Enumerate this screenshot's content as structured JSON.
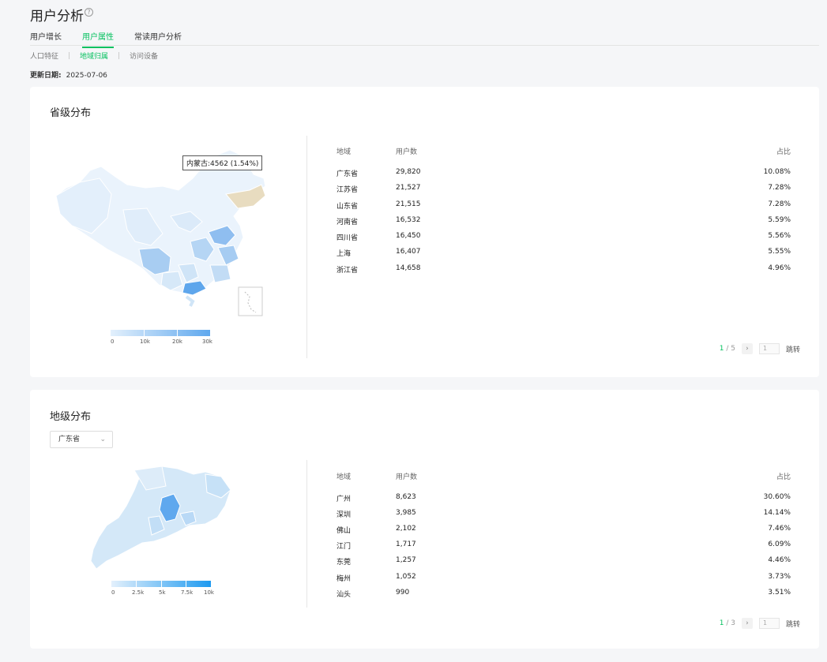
{
  "header": {
    "title": "用户分析",
    "help_icon": "?"
  },
  "tabs": [
    {
      "label": "用户增长",
      "active": false
    },
    {
      "label": "用户属性",
      "active": true
    },
    {
      "label": "常读用户分析",
      "active": false
    }
  ],
  "subtabs": [
    {
      "label": "人口特征",
      "active": false
    },
    {
      "label": "地域归属",
      "active": true
    },
    {
      "label": "访问设备",
      "active": false
    }
  ],
  "update": {
    "label": "更新日期:",
    "date": "2025-07-06"
  },
  "province": {
    "title": "省级分布",
    "tooltip": "内蒙古:4562 (1.54%)",
    "legend_ticks": [
      "0",
      "10k",
      "20k",
      "30k"
    ],
    "headers": {
      "region": "地域",
      "users": "用户数",
      "ratio": "占比"
    },
    "rows": [
      {
        "region": "广东省",
        "users": "29,820",
        "ratio": "10.08%"
      },
      {
        "region": "江苏省",
        "users": "21,527",
        "ratio": "7.28%"
      },
      {
        "region": "山东省",
        "users": "21,515",
        "ratio": "7.28%"
      },
      {
        "region": "河南省",
        "users": "16,532",
        "ratio": "5.59%"
      },
      {
        "region": "四川省",
        "users": "16,450",
        "ratio": "5.56%"
      },
      {
        "region": "上海",
        "users": "16,407",
        "ratio": "5.55%"
      },
      {
        "region": "浙江省",
        "users": "14,658",
        "ratio": "4.96%"
      }
    ],
    "pager": {
      "current": "1",
      "total": "/ 5",
      "next": "›",
      "input": "1",
      "jump": "跳转"
    }
  },
  "city": {
    "title": "地级分布",
    "select_value": "广东省",
    "legend_ticks": [
      "0",
      "2.5k",
      "5k",
      "7.5k",
      "10k"
    ],
    "headers": {
      "region": "地域",
      "users": "用户数",
      "ratio": "占比"
    },
    "rows": [
      {
        "region": "广州",
        "users": "8,623",
        "ratio": "30.60%"
      },
      {
        "region": "深圳",
        "users": "3,985",
        "ratio": "14.14%"
      },
      {
        "region": "佛山",
        "users": "2,102",
        "ratio": "7.46%"
      },
      {
        "region": "江门",
        "users": "1,717",
        "ratio": "6.09%"
      },
      {
        "region": "东莞",
        "users": "1,257",
        "ratio": "4.46%"
      },
      {
        "region": "梅州",
        "users": "1,052",
        "ratio": "3.73%"
      },
      {
        "region": "汕头",
        "users": "990",
        "ratio": "3.51%"
      }
    ],
    "pager": {
      "current": "1",
      "total": "/ 3",
      "next": "›",
      "input": "1",
      "jump": "跳转"
    }
  }
}
